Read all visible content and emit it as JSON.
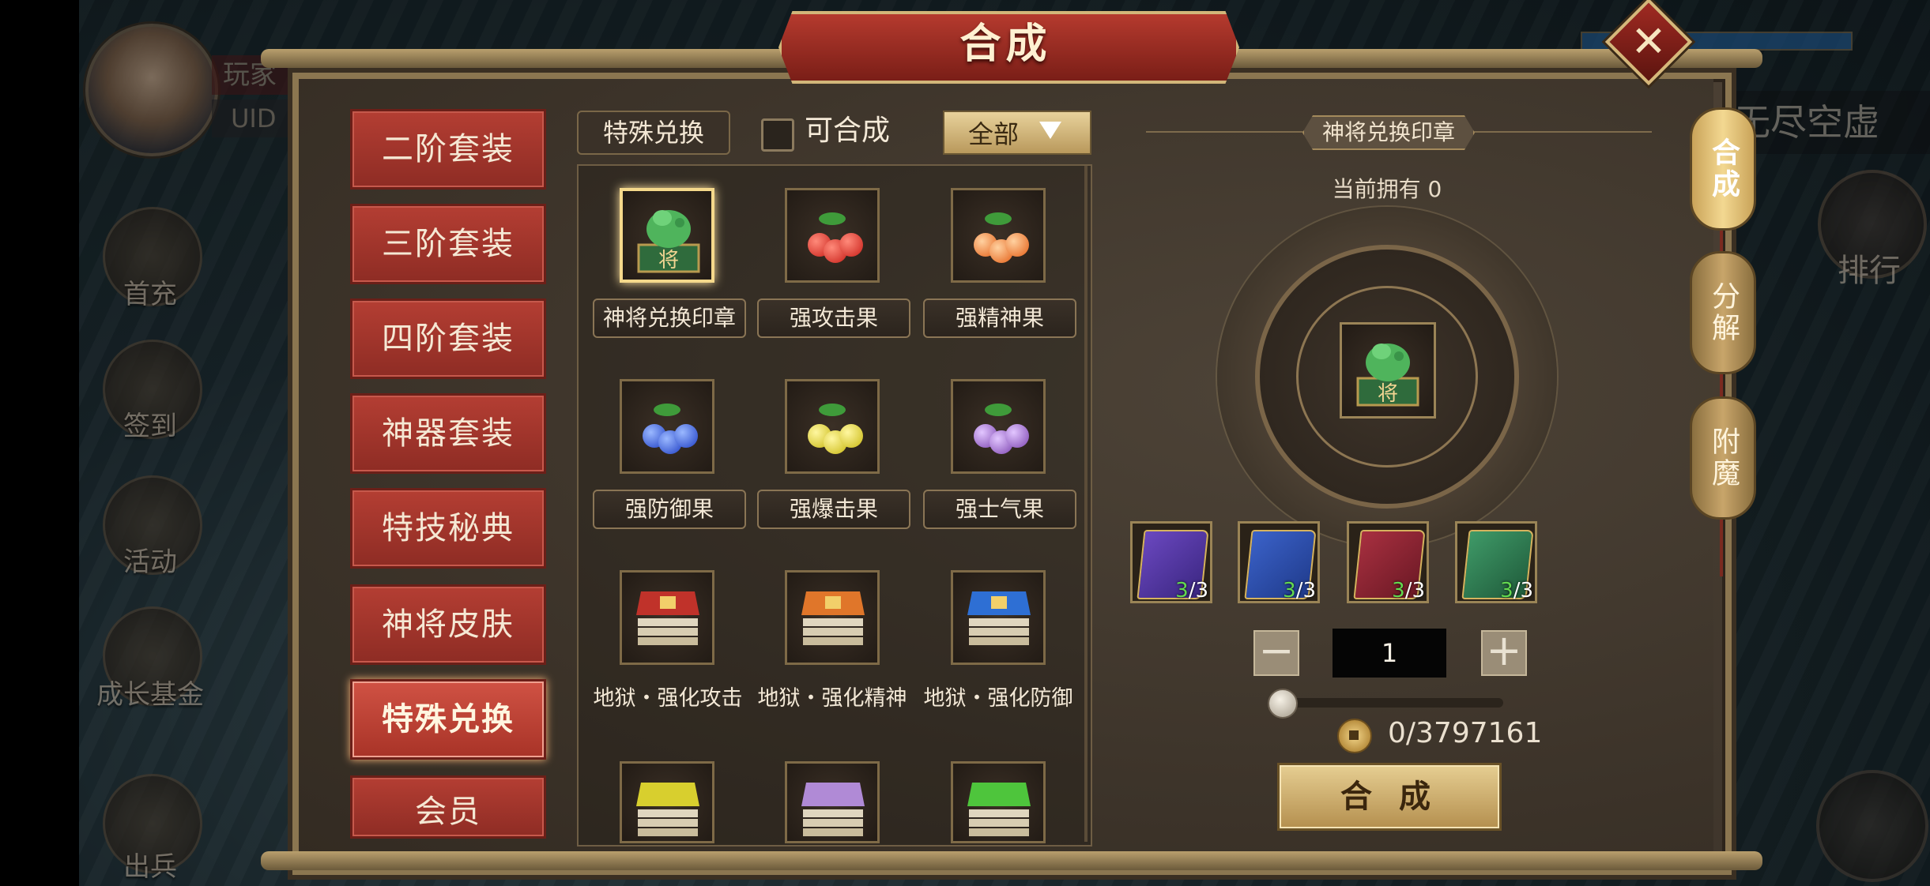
{
  "title": "合成",
  "background_hud": {
    "player_name_partial": "玩家",
    "uid_label": "UID",
    "right_title_partial": "无尽空虚",
    "rank_label": "排行",
    "left_buttons": [
      "首充",
      "签到",
      "活动",
      "成长基金",
      "出兵"
    ]
  },
  "categories": [
    {
      "label": "二阶套装",
      "active": false
    },
    {
      "label": "三阶套装",
      "active": false
    },
    {
      "label": "四阶套装",
      "active": false
    },
    {
      "label": "神器套装",
      "active": false
    },
    {
      "label": "特技秘典",
      "active": false
    },
    {
      "label": "神将皮肤",
      "active": false
    },
    {
      "label": "特殊兑换",
      "active": true
    },
    {
      "label": "会员",
      "active": false
    }
  ],
  "filter": {
    "current_tab": "特殊兑换",
    "checkbox_label": "可合成",
    "checkbox_checked": false,
    "dropdown_value": "全部"
  },
  "items": [
    {
      "label": "神将兑换印章",
      "art": "jade-seal",
      "selected": true
    },
    {
      "label": "强攻击果",
      "art": "fruit",
      "color": "#d8342b"
    },
    {
      "label": "强精神果",
      "art": "fruit",
      "color": "#f07a2a"
    },
    {
      "label": "强防御果",
      "art": "fruit",
      "color": "#2f54d6"
    },
    {
      "label": "强爆击果",
      "art": "fruit",
      "color": "#e4d52c"
    },
    {
      "label": "强士气果",
      "art": "fruit",
      "color": "#9a66c8"
    },
    {
      "label": "地狱・强化攻击",
      "art": "book",
      "color": "#c0322a"
    },
    {
      "label": "地狱・强化精神",
      "art": "book",
      "color": "#e0762a"
    },
    {
      "label": "地狱・强化防御",
      "art": "book",
      "color": "#2e6fd4"
    },
    {
      "label": "",
      "art": "book",
      "color": "#d8cf2e"
    },
    {
      "label": "",
      "art": "book",
      "color": "#b08ad6"
    },
    {
      "label": "",
      "art": "book",
      "color": "#4ec53c"
    }
  ],
  "detail": {
    "name": "神将兑换印章",
    "owned_text": "当前拥有 0",
    "materials": [
      {
        "color": "#5b3aa5",
        "have": "3",
        "need": "/3"
      },
      {
        "color": "#2a4ca8",
        "have": "3",
        "need": "/3"
      },
      {
        "color": "#8a2430",
        "have": "3",
        "need": "/3"
      },
      {
        "color": "#2f7a52",
        "have": "3",
        "need": "/3"
      }
    ],
    "quantity": "1",
    "minus_label": "−",
    "plus_label": "+",
    "cost_text": "0/3797161",
    "synth_button": "合 成"
  },
  "side_tabs": [
    {
      "label": "合成",
      "active": true
    },
    {
      "label": "分解",
      "active": false
    },
    {
      "label": "附魔",
      "active": false
    }
  ],
  "close_label": "✕"
}
